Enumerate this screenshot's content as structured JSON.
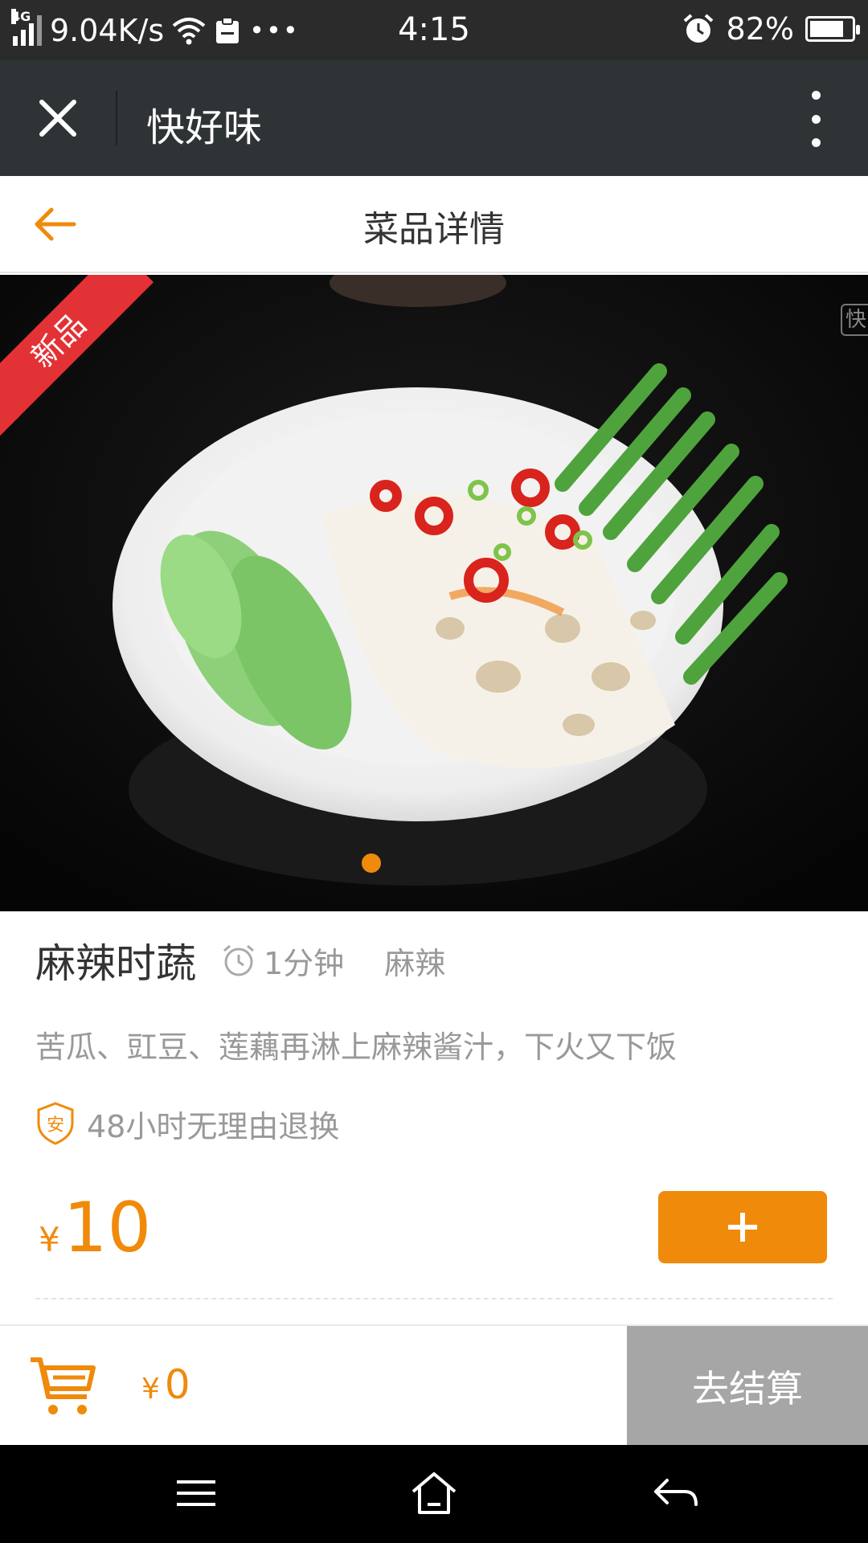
{
  "status_bar": {
    "network_type": "4G",
    "speed": "9.04K/s",
    "time": "4:15",
    "battery": "82%",
    "battery_level": 0.82
  },
  "app_bar": {
    "title": "快好味",
    "close_icon": "close-icon",
    "more_icon": "more-vertical-icon"
  },
  "page_header": {
    "title": "菜品详情",
    "back_icon": "arrow-left-icon"
  },
  "hero": {
    "badge": "新品",
    "watermark": "快",
    "carousel_count": 1,
    "carousel_active": 0
  },
  "dish": {
    "name": "麻辣时蔬",
    "cook_time": "1分钟",
    "flavor": "麻辣",
    "description": "苦瓜、豇豆、莲藕再淋上麻辣酱汁，下火又下饭",
    "guarantee_icon_text": "安",
    "guarantee": "48小时无理由退换",
    "currency": "¥",
    "price": "10",
    "add_icon": "plus-icon"
  },
  "cart": {
    "currency": "¥",
    "total": "0",
    "checkout_label": "去结算"
  },
  "colors": {
    "accent": "#f08a0a",
    "ribbon": "#e23235",
    "appbar": "#2e3336",
    "checkout_disabled": "#a6a6a6"
  }
}
